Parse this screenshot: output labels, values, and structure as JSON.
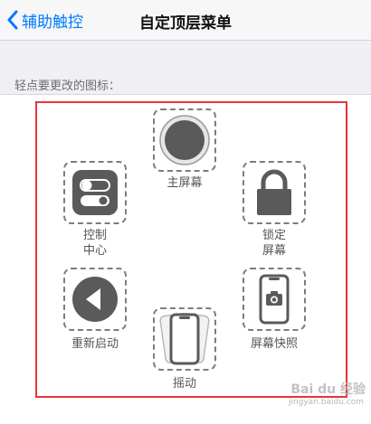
{
  "nav": {
    "back_label": "辅助触控",
    "title": "自定顶层菜单"
  },
  "section": {
    "hint": "轻点要更改的图标："
  },
  "menu_items": [
    {
      "label": "主屏幕",
      "icon": "home-circle-icon"
    },
    {
      "label": "控制\n中心",
      "icon": "control-center-toggles-icon"
    },
    {
      "label": "锁定\n屏幕",
      "icon": "lock-icon"
    },
    {
      "label": "重新启动",
      "icon": "restart-play-icon"
    },
    {
      "label": "屏幕快照",
      "icon": "screenshot-phone-camera-icon"
    },
    {
      "label": "摇动",
      "icon": "shake-phones-icon"
    }
  ],
  "watermark": {
    "text": "Bai du 经验",
    "sub": "jingyan.baidu.com"
  },
  "colors": {
    "accent": "#007aff",
    "highlight_border": "#e8343a",
    "icon_dark": "#5a5a5a"
  }
}
